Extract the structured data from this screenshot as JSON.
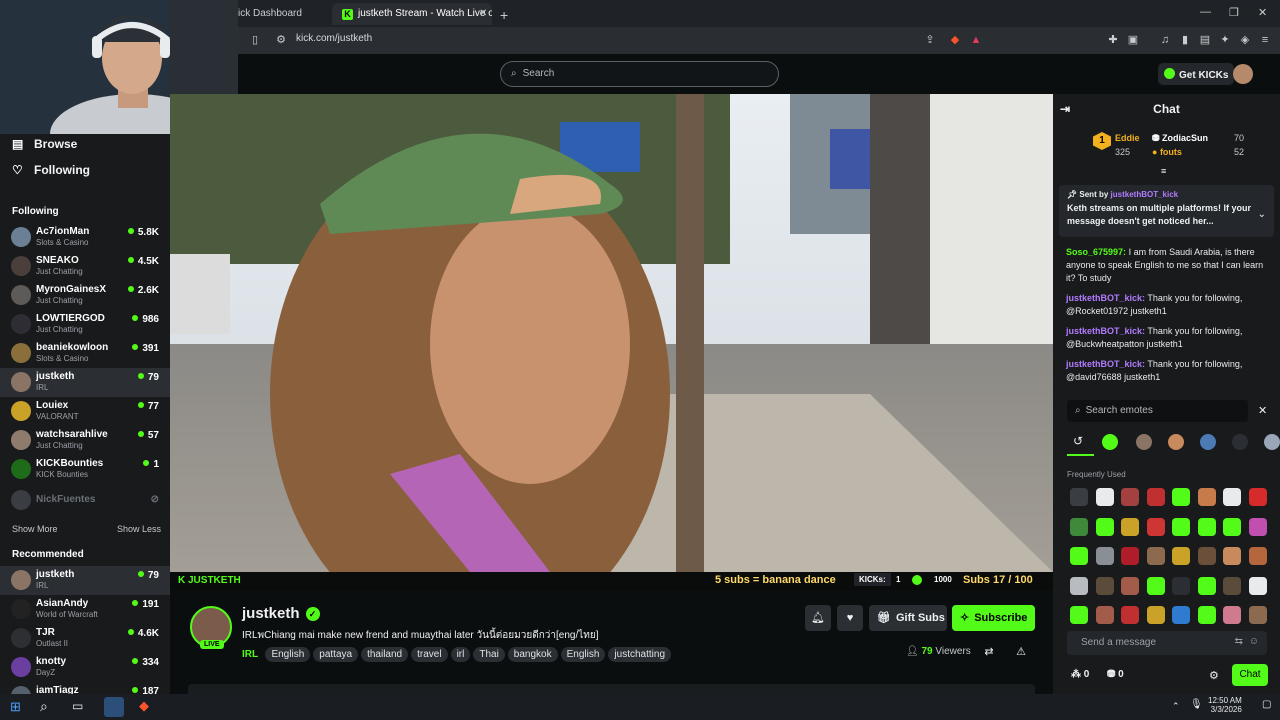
{
  "browser": {
    "tabs": [
      {
        "label": "ick Dashboard"
      },
      {
        "label": "justketh Stream - Watch Live o"
      }
    ],
    "url": "kick.com/justketh"
  },
  "header": {
    "search_placeholder": "Search",
    "get_kicks_label": "Get KICKs"
  },
  "sidebar": {
    "nav": [
      {
        "label": "Browse",
        "icon": "browse-icon"
      },
      {
        "label": "Following",
        "icon": "heart-icon"
      }
    ],
    "following_title": "Following",
    "following": [
      {
        "name": "Ac7ionMan",
        "category": "Slots & Casino",
        "viewers": "5.8K"
      },
      {
        "name": "SNEAKO",
        "category": "Just Chatting",
        "viewers": "4.5K"
      },
      {
        "name": "MyronGainesX",
        "category": "Just Chatting",
        "viewers": "2.6K"
      },
      {
        "name": "LOWTIERGOD",
        "category": "Just Chatting",
        "viewers": "986"
      },
      {
        "name": "beaniekowloon",
        "category": "Slots & Casino",
        "viewers": "391"
      },
      {
        "name": "justketh",
        "category": "IRL",
        "viewers": "79"
      },
      {
        "name": "Louiex",
        "category": "VALORANT",
        "viewers": "77"
      },
      {
        "name": "watchsarahlive",
        "category": "Just Chatting",
        "viewers": "57"
      },
      {
        "name": "KICKBounties",
        "category": "KICK Bounties",
        "viewers": "1"
      },
      {
        "name": "NickFuentes",
        "category": "",
        "viewers": ""
      }
    ],
    "show_more": "Show More",
    "show_less": "Show Less",
    "recommended_title": "Recommended",
    "recommended": [
      {
        "name": "justketh",
        "category": "IRL",
        "viewers": "79"
      },
      {
        "name": "AsianAndy",
        "category": "World of Warcraft",
        "viewers": "191"
      },
      {
        "name": "TJR",
        "category": "Outlast II",
        "viewers": "4.6K"
      },
      {
        "name": "knotty",
        "category": "DayZ",
        "viewers": "334"
      },
      {
        "name": "iamTiagz",
        "category": "",
        "viewers": "187"
      }
    ]
  },
  "overlay": {
    "brand": "JUSTKETH",
    "promo": "5 subs = banana dance",
    "kicks_label": "KICKs:",
    "kicks_value": "1",
    "kicks_goal": "1000",
    "subs_text": "Subs 17 / 100"
  },
  "stream": {
    "channel": "justketh",
    "live_label": "LIVE",
    "title": "IRLพChiang mai make new frend and muaythai later วันนี้ต่อยมวยดีกว่า[eng/ไทย]",
    "category": "IRL",
    "tags": [
      "English",
      "pattaya",
      "thailand",
      "travel",
      "irl",
      "Thai",
      "bangkok",
      "English",
      "justchatting"
    ],
    "gift_subs_label": "Gift Subs",
    "subscribe_label": "Subscribe",
    "viewers_count": "79",
    "viewers_label": "Viewers"
  },
  "chat": {
    "title": "Chat",
    "leaderboard": [
      {
        "name": "Eddie",
        "value": "70"
      },
      {
        "name": "ZodiacSun",
        "value": "70"
      },
      {
        "name": "",
        "value": "325"
      },
      {
        "name": "fouts",
        "value": "52"
      }
    ],
    "pinned": {
      "sent_by_label": "Sent by",
      "sender": "justkethBOT_kick",
      "text": "Keth streams on multiple platforms! If your message doesn't get noticed her..."
    },
    "messages": [
      {
        "user": "Soso_675997:",
        "text": "I am from Saudi Arabia, is there anyone to speak English to me so that I can learn it? To study"
      },
      {
        "user": "justkethBOT_kick:",
        "text": "Thank you for following, @Rocket01972 justketh1"
      },
      {
        "user": "justkethBOT_kick:",
        "text": "Thank you for following, @Buckwheatpatton justketh1"
      },
      {
        "user": "justkethBOT_kick:",
        "text": "Thank you for following, @david76688 justketh1"
      }
    ],
    "emote_search_placeholder": "Search emotes",
    "frequently_used": "Frequently Used",
    "send_placeholder": "Send a message",
    "kicks_count": "0",
    "gift_count": "0",
    "chat_button": "Chat"
  },
  "taskbar": {
    "time": "12:50 AM",
    "date": "3/3/2026"
  },
  "colors": {
    "accent": "#53fc18",
    "background": "#0b0e0f",
    "panel": "#181a1c"
  }
}
